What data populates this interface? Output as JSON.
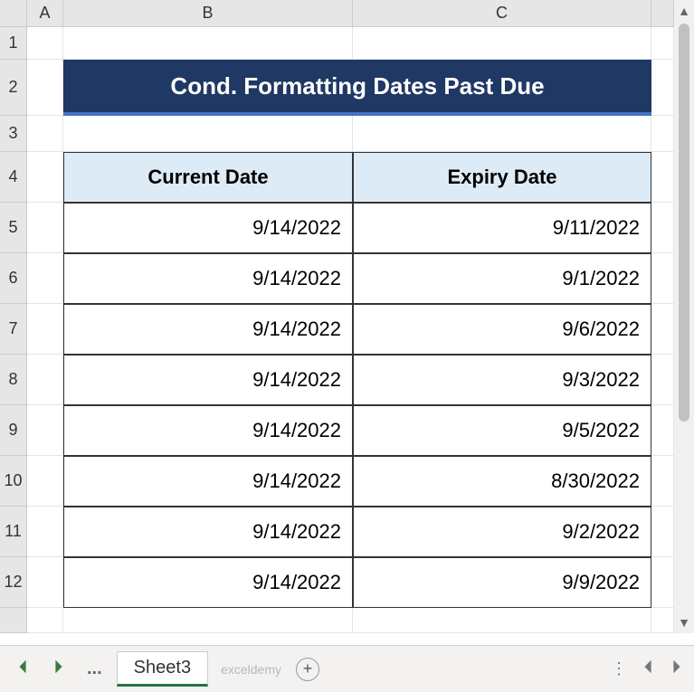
{
  "columns": [
    "A",
    "B",
    "C"
  ],
  "rows": [
    "1",
    "2",
    "3",
    "4",
    "5",
    "6",
    "7",
    "8",
    "9",
    "10",
    "11",
    "12"
  ],
  "title": "Cond. Formatting Dates Past Due",
  "table": {
    "headers": [
      "Current Date",
      "Expiry Date"
    ],
    "data": [
      [
        "9/14/2022",
        "9/11/2022"
      ],
      [
        "9/14/2022",
        "9/1/2022"
      ],
      [
        "9/14/2022",
        "9/6/2022"
      ],
      [
        "9/14/2022",
        "9/3/2022"
      ],
      [
        "9/14/2022",
        "9/5/2022"
      ],
      [
        "9/14/2022",
        "8/30/2022"
      ],
      [
        "9/14/2022",
        "9/2/2022"
      ],
      [
        "9/14/2022",
        "9/9/2022"
      ]
    ]
  },
  "sheet_tab": "Sheet3",
  "watermark": "exceldemy",
  "nav": {
    "dots": "...",
    "plus": "+"
  }
}
